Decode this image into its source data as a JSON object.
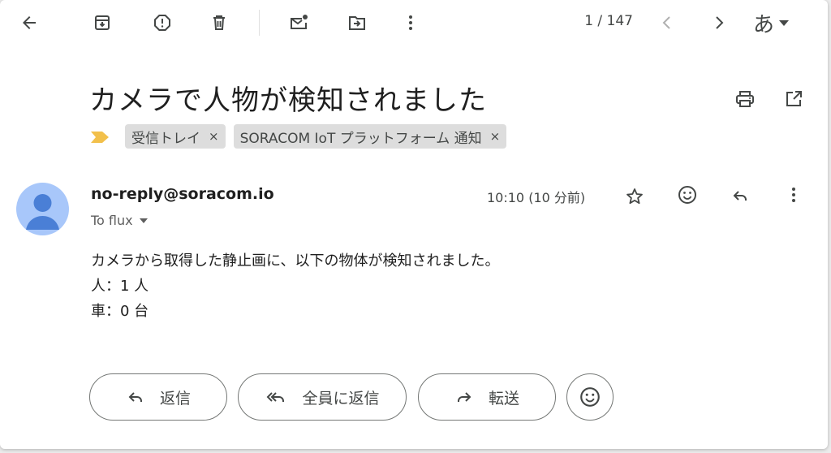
{
  "toolbar": {
    "back_icon": "arrow-left-icon",
    "archive_icon": "archive-icon",
    "report_spam_icon": "report-icon",
    "delete_icon": "trash-icon",
    "mark_unread_icon": "mark-unread-icon",
    "move_to_icon": "move-to-icon",
    "more_icon": "more-vertical-icon",
    "pager": "1 / 147",
    "older_icon": "chevron-left-icon",
    "newer_icon": "chevron-right-icon",
    "language": "あ"
  },
  "message": {
    "subject": "カメラで人物が検知されました",
    "labels": [
      {
        "name": "受信トレイ",
        "remove": "×"
      },
      {
        "name": "SORACOM IoT プラットフォーム 通知",
        "remove": "×"
      }
    ],
    "sender": "no-reply@soracom.io",
    "to": "To flux",
    "time": "10:10 (10 分前)",
    "body_lines": [
      "カメラから取得した静止画に、以下の物体が検知されました。",
      "人：1 人",
      "車：0 台"
    ]
  },
  "actions": {
    "reply": "返信",
    "reply_all": "全員に返信",
    "forward": "転送"
  },
  "colors": {
    "importance_marker": "#f2c04b",
    "avatar_bg": "#a8c7fa",
    "avatar_fg": "#4a7fd6",
    "chip_bg": "#dddddd"
  }
}
